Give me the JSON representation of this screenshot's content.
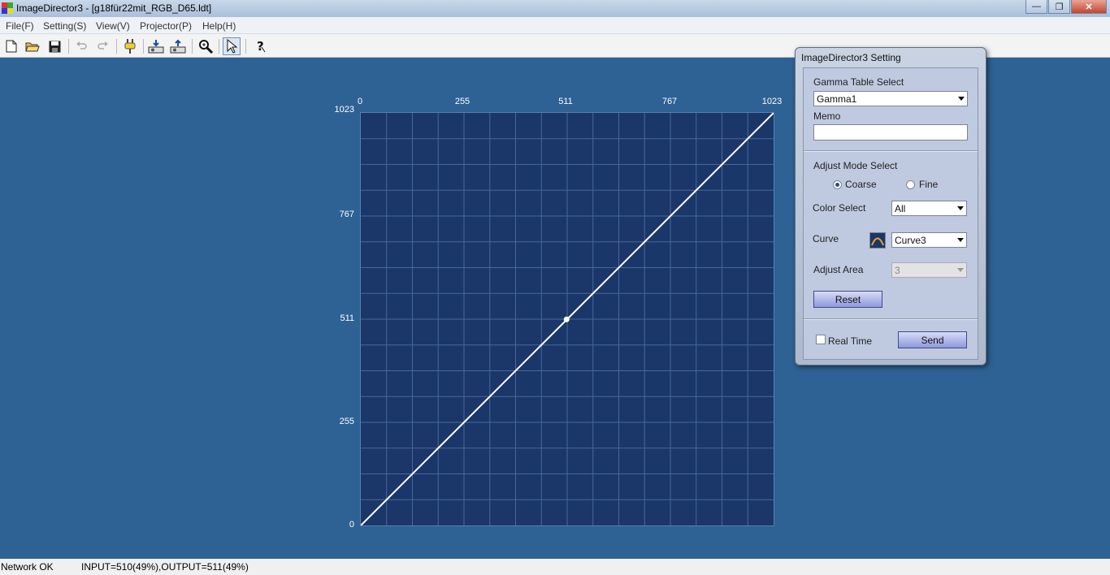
{
  "window": {
    "title": "ImageDirector3 - [g18für22mit_RGB_D65.ldt]",
    "minimize_label": "—",
    "restore_label": "❐",
    "close_label": "✕"
  },
  "menu": {
    "items": [
      "File(F)",
      "Setting(S)",
      "View(V)",
      "Projector(P)",
      "Help(H)"
    ]
  },
  "toolbar": {
    "icons": [
      "new-file-icon",
      "open-folder-icon",
      "save-icon",
      "undo-icon",
      "redo-icon",
      "connect-plug-icon",
      "download-to-projector-icon",
      "upload-from-projector-icon",
      "zoom-icon",
      "pointer-select-icon",
      "help-icon"
    ]
  },
  "chart_data": {
    "type": "line",
    "title": "",
    "xlabel": "",
    "ylabel": "",
    "xlim": [
      0,
      1023
    ],
    "ylim": [
      0,
      1023
    ],
    "x_ticks": [
      "0",
      "255",
      "511",
      "767",
      "1023"
    ],
    "y_ticks": [
      "1023",
      "767",
      "511",
      "255",
      "0"
    ],
    "grid": true,
    "series": [
      {
        "x": [
          0,
          1023
        ],
        "y": [
          0,
          1023
        ]
      }
    ],
    "control_points": [
      {
        "x": 510,
        "y": 511
      }
    ]
  },
  "status": {
    "network": "Network OK",
    "io": "INPUT=510(49%),OUTPUT=511(49%)"
  },
  "dialog": {
    "title": "ImageDirector3 Setting",
    "gamma_table_label": "Gamma Table Select",
    "gamma_table_value": "Gamma1",
    "memo_label": "Memo",
    "memo_value": "",
    "adjust_mode_label": "Adjust Mode Select",
    "mode_coarse": "Coarse",
    "mode_fine": "Fine",
    "color_select_label": "Color Select",
    "color_select_value": "All",
    "curve_label": "Curve",
    "curve_value": "Curve3",
    "adjust_area_label": "Adjust Area",
    "adjust_area_value": "3",
    "reset_label": "Reset",
    "realtime_label": "Real Time",
    "send_label": "Send"
  }
}
